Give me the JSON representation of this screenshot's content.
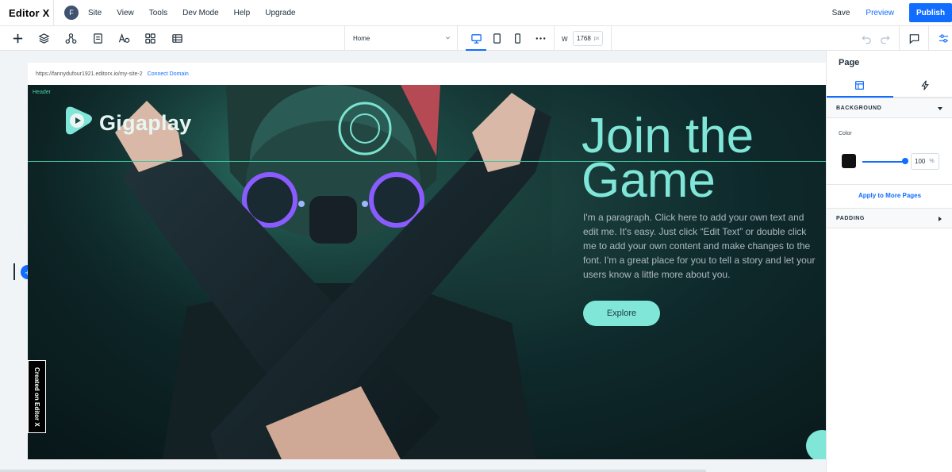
{
  "topbar": {
    "logo": "Editor X",
    "avatar_initial": "F",
    "menu": [
      "Site",
      "View",
      "Tools",
      "Dev Mode",
      "Help",
      "Upgrade"
    ],
    "save_label": "Save",
    "preview_label": "Preview",
    "publish_label": "Publish"
  },
  "toolbar": {
    "page_selected": "Home",
    "width_label": "W",
    "width_value": "1768",
    "width_unit": "px"
  },
  "canvas": {
    "url": "https://fannydufour1921.editorx.io/my-site-2",
    "connect_domain": "Connect Domain",
    "add_section_symbol": "+"
  },
  "site": {
    "header_tag": "Header",
    "brand_name": "Gigaplay",
    "headline": "Join the\nGame",
    "paragraph": "I'm a paragraph. Click here to add your own text and edit me. It's easy. Just click “Edit Text” or double click me to add your own content and make changes to the font. I'm a great place for you to tell a story and let your users know a little more about you.",
    "button_label": "Explore",
    "created_badge": "Created on Editor X"
  },
  "panel": {
    "title": "Page",
    "background_section": "BACKGROUND",
    "color_label": "Color",
    "opacity_value": "100",
    "opacity_unit": "%",
    "apply_label": "Apply to More Pages",
    "padding_section": "PADDING",
    "background_color": "#111111"
  },
  "colors": {
    "accent": "#116dff",
    "site_accent": "#7fe6d8"
  }
}
